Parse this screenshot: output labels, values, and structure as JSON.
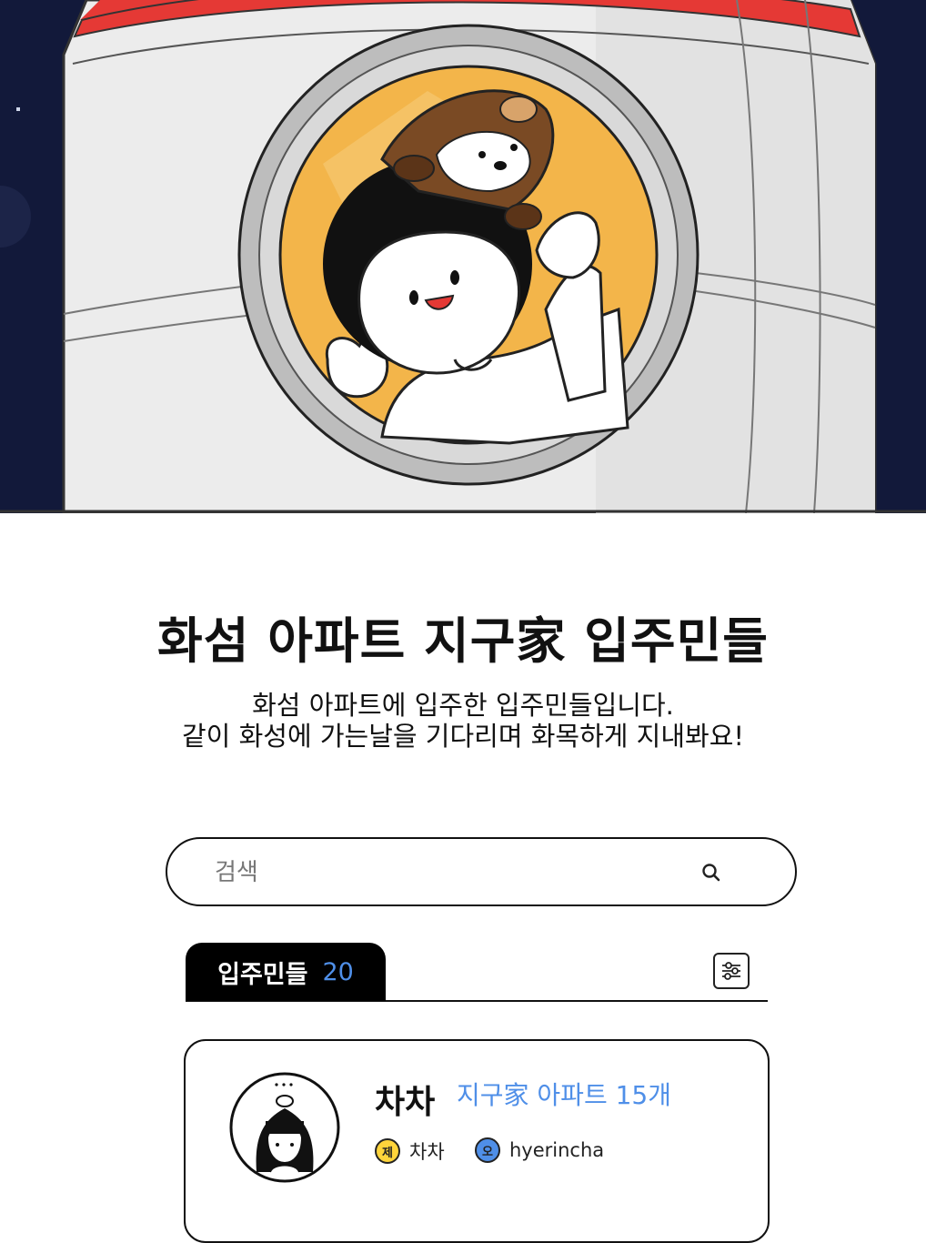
{
  "hero": {
    "colors": {
      "space": "#12193a",
      "hull": "#eeeeee",
      "stripe": "#e53935",
      "window_bg": "#f3b54a"
    }
  },
  "header": {
    "title": "화섬 아파트 지구家 입주민들",
    "subtitle_line1": "화섬 아파트에 입주한 입주민들입니다.",
    "subtitle_line2": "같이 화성에 가는날을 기다리며 화목하게 지내봐요!"
  },
  "search": {
    "placeholder": "검색",
    "value": "",
    "icon": "search-icon"
  },
  "tabs": {
    "label": "입주민들",
    "count": "20",
    "filter_icon": "sliders-icon"
  },
  "members": [
    {
      "name": "차차",
      "apartment_count": "지구家 아파트 15개",
      "tag1_badge": "제",
      "tag1_text": "차차",
      "tag2_badge": "오",
      "tag2_text": "hyerincha"
    }
  ],
  "colors": {
    "accent": "#4f8fe8",
    "badge_yellow": "#ffd43b",
    "badge_blue": "#4f8fe8",
    "tab_bg": "#000000"
  }
}
